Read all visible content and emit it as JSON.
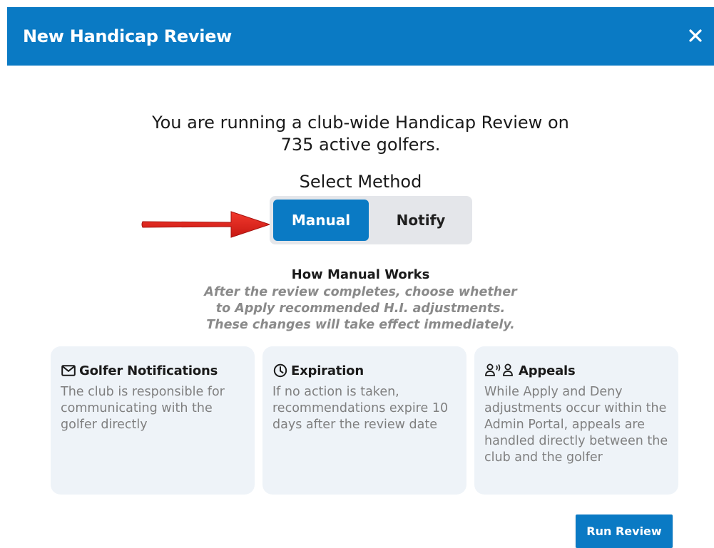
{
  "colors": {
    "accent": "#0a7ac4",
    "card_bg": "#eef3f8",
    "toggle_bg": "#e4e6ea",
    "arrow": "#e0211d",
    "muted_text": "#7f7f7f"
  },
  "modal": {
    "title": "New Handicap Review",
    "close_icon": "close-icon"
  },
  "intro": {
    "line1": "You are running a club-wide Handicap Review on",
    "line2": "735 active golfers."
  },
  "method": {
    "heading": "Select Method",
    "options": [
      {
        "label": "Manual",
        "selected": true
      },
      {
        "label": "Notify",
        "selected": false
      }
    ]
  },
  "how": {
    "title": "How Manual Works",
    "lines": [
      "After the review completes, choose whether",
      "to Apply recommended H.I. adjustments.",
      "These changes will take effect immediately."
    ]
  },
  "cards": [
    {
      "icon": "mail-icon",
      "title": "Golfer Notifications",
      "body": "The club is responsible for communicating with the golfer directly"
    },
    {
      "icon": "clock-icon",
      "title": "Expiration",
      "body": "If no action is taken, recommendations expire 10 days after the review date"
    },
    {
      "icon": "people-talking-icon",
      "title": "Appeals",
      "body": "While Apply and Deny adjustments occur within the Admin Portal, appeals are handled directly between the club and the golfer"
    }
  ],
  "footer": {
    "run_label": "Run Review"
  }
}
